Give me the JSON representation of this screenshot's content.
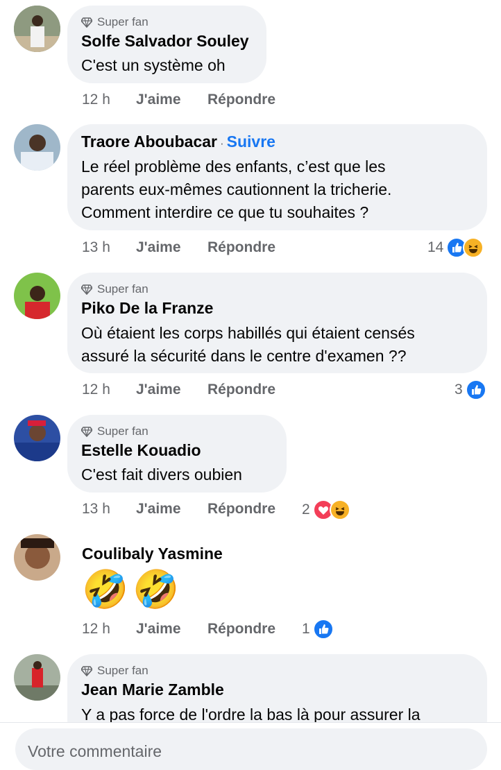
{
  "comments": [
    {
      "badge": "Super fan",
      "author": "Solfe Salvador Souley",
      "lines": [
        "C'est un système oh"
      ],
      "time": "12 h",
      "like_label": "J'aime",
      "reply_label": "Répondre"
    },
    {
      "author": "Traore Aboubacar",
      "follow_label": "Suivre",
      "lines": [
        "Le réel problème des enfants, c’est que les",
        "parents eux-mêmes cautionnent la tricherie.",
        "Comment interdire ce que tu souhaites ?"
      ],
      "time": "13 h",
      "like_label": "J'aime",
      "reply_label": "Répondre",
      "reaction_count": "14",
      "reactions": [
        "like-icon",
        "haha-icon"
      ]
    },
    {
      "badge": "Super fan",
      "author": "Piko De la Franze",
      "lines": [
        "Où étaient les corps habillés qui étaient censés",
        "assuré la sécurité dans le centre d'examen ??"
      ],
      "time": "12 h",
      "like_label": "J'aime",
      "reply_label": "Répondre",
      "reaction_count": "3",
      "reactions": [
        "like-icon"
      ]
    },
    {
      "badge": "Super fan",
      "author": "Estelle Kouadio",
      "lines": [
        "C'est fait divers oubien"
      ],
      "time": "13 h",
      "like_label": "J'aime",
      "reply_label": "Répondre",
      "reaction_count": "2",
      "reactions": [
        "love-icon",
        "haha-icon"
      ]
    },
    {
      "author": "Coulibaly Yasmine",
      "emoji": "🤣🤣",
      "time": "12 h",
      "like_label": "J'aime",
      "reply_label": "Répondre",
      "reaction_count": "1",
      "reactions": [
        "like-icon"
      ]
    },
    {
      "badge": "Super fan",
      "author": "Jean Marie Zamble",
      "lines": [
        "Y a pas force de l'ordre la bas là pour assurer la"
      ]
    }
  ],
  "composer": {
    "placeholder": "Votre commentaire"
  },
  "colors": {
    "accent": "#1877f2",
    "bubble": "#f0f2f5",
    "muted": "#65676b"
  }
}
